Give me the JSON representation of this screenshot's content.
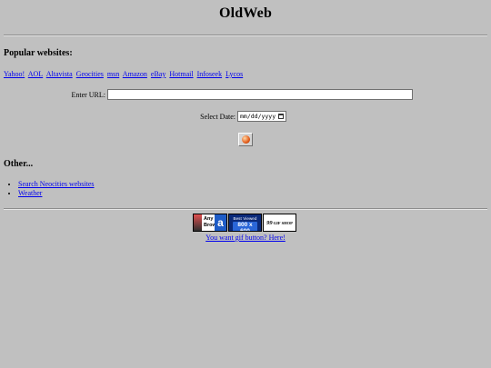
{
  "header": {
    "title": "OldWeb"
  },
  "popular": {
    "heading": "Popular websites:",
    "links": [
      "Yahoo!",
      "AOL",
      "Altavista",
      "Geocities",
      "msn",
      "Amazon",
      "eBay",
      "Hotmail",
      "Infoseek",
      "Lycos"
    ]
  },
  "form": {
    "url_label": "Enter URL:",
    "url_value": "",
    "date_label": "Select Date:",
    "date_placeholder": "mm/dd/yyyy",
    "go_icon": "go-orb-icon"
  },
  "other": {
    "heading": "Other...",
    "links": [
      "Search Neocities websites",
      "Weather"
    ]
  },
  "badges": {
    "any_browser": {
      "line1": "Any",
      "line2": "Browser",
      "letter": "a"
    },
    "best_viewed": {
      "line1": "Best Viewed",
      "line2": "800 x 600"
    },
    "gif_shop": {
      "price": "99",
      "text": "GIF SHOP"
    }
  },
  "gif_link": "You want gif button? Here!"
}
